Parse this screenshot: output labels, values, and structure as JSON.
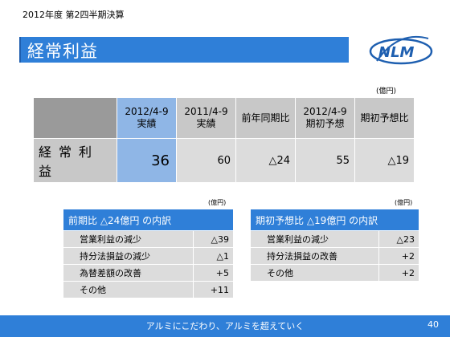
{
  "header": {
    "period": "2012年度  第2四半期決算",
    "title": "経常利益"
  },
  "logo": {
    "text": "NLM"
  },
  "main_table": {
    "unit": "(億円)",
    "columns": [
      "2012/4-9\n実績",
      "2011/4-9\n実績",
      "前年同期比",
      "2012/4-9\n期初予想",
      "期初予想比"
    ],
    "row_label": "経常利益",
    "values": [
      "36",
      "60",
      "△24",
      "55",
      "△19"
    ]
  },
  "left_breakdown": {
    "unit": "(億円)",
    "title": "前期比  △24億円  の内訳",
    "rows": [
      {
        "item": "営業利益の減少",
        "value": "△39"
      },
      {
        "item": "持分法損益の減少",
        "value": "△1"
      },
      {
        "item": "為替差額の改善",
        "value": "+5"
      },
      {
        "item": "その他",
        "value": "+11"
      }
    ]
  },
  "right_breakdown": {
    "unit": "(億円)",
    "title": "期初予想比  △19億円  の内訳",
    "rows": [
      {
        "item": "営業利益の減少",
        "value": "△23"
      },
      {
        "item": "持分法損益の改善",
        "value": "+2"
      },
      {
        "item": "その他",
        "value": "+2"
      }
    ]
  },
  "footer": {
    "slogan": "アルミにこだわり、アルミを超えていく",
    "page": "40"
  },
  "colors": {
    "accent_blue": "#2f7fd8",
    "highlight_blue": "#8fb6e6",
    "header_gray": "#c8c8c8",
    "cell_gray": "#dcdcdc"
  }
}
